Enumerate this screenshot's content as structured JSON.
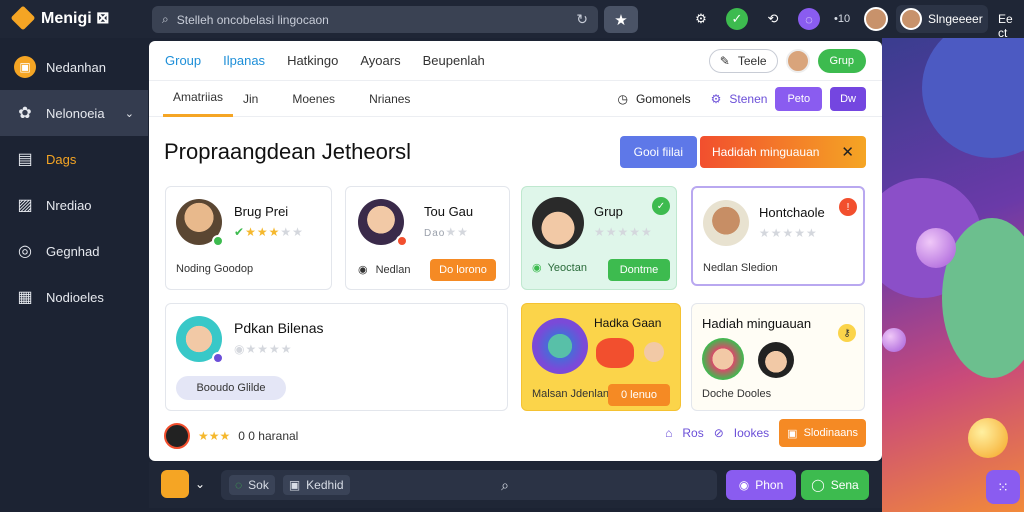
{
  "app": {
    "title": "Menigi ⊠"
  },
  "search": {
    "text": "Stelleh oncobelasi lingocaon"
  },
  "topbar": {
    "icon_text": "•10",
    "user_name": "Slngeeeer",
    "right_text": "Ee ct"
  },
  "sidebar": {
    "items": [
      {
        "label": "Nedanhan",
        "icon": "orange-circle-icon"
      },
      {
        "label": "Nelonoeia",
        "icon": "puzzle-icon",
        "has_chevron": true
      },
      {
        "label": "Dags",
        "icon": "list-icon"
      },
      {
        "label": "Nrediao",
        "icon": "image-icon"
      },
      {
        "label": "Gegnhad",
        "icon": "compass-icon"
      },
      {
        "label": "Nodioeles",
        "icon": "grid-icon"
      }
    ]
  },
  "tabs_primary": [
    "Group",
    "Ilpanas",
    "Hatkingo",
    "Ayoars",
    "Beupenlah"
  ],
  "toolbar": {
    "teele_label": "Teele",
    "grup_label": "Grup"
  },
  "tabs_secondary": [
    "Amatriias",
    "Jin",
    "Moenes",
    "Nrianes"
  ],
  "toolbar2": {
    "gomonels": "Gomonels",
    "stenen": "Stenen",
    "btn1": "Peto",
    "btn2": "Dw"
  },
  "page": {
    "title": "Propraangdean Jetheorsl",
    "btn_blue": "Gooi fiilai",
    "btn_orange": "Hadidah minguauan"
  },
  "cards": [
    {
      "name": "Brug Prei",
      "foot": "Noding Goodop",
      "stars": 3
    },
    {
      "name": "Tou Gau",
      "sub": "Dao",
      "foot": "Nedlan",
      "btn": "Do lorono",
      "stars": 1
    },
    {
      "name": "Grup",
      "foot": "Yeoctan",
      "btn": "Dontme",
      "stars": 0
    },
    {
      "name": "Hontchaole",
      "foot": "Nedlan Sledion",
      "stars": 0
    },
    {
      "name": "Pdkan Bilenas",
      "btn": "Booudo Glilde",
      "stars": 1
    },
    {
      "name": "Hadka Gaan",
      "foot": "Malsan Jdenlan",
      "btn": "0 lenuo"
    },
    {
      "name": "Hadiah minguauan",
      "foot": "Doche Dooles"
    }
  ],
  "bottom_row": {
    "left_text": "0 0 haranal",
    "ros": "Ros",
    "lookes": "Iookes",
    "btn": "Slodinaans"
  },
  "bottombar": {
    "tag1": "Sok",
    "tag2": "Kedhid",
    "btn_violet": "Phon",
    "btn_green": "Sena"
  },
  "colors": {
    "accent_orange": "#f5a524",
    "accent_violet": "#8a5cf0",
    "accent_green": "#3dbb4f",
    "dark_bg": "#1f2636"
  }
}
